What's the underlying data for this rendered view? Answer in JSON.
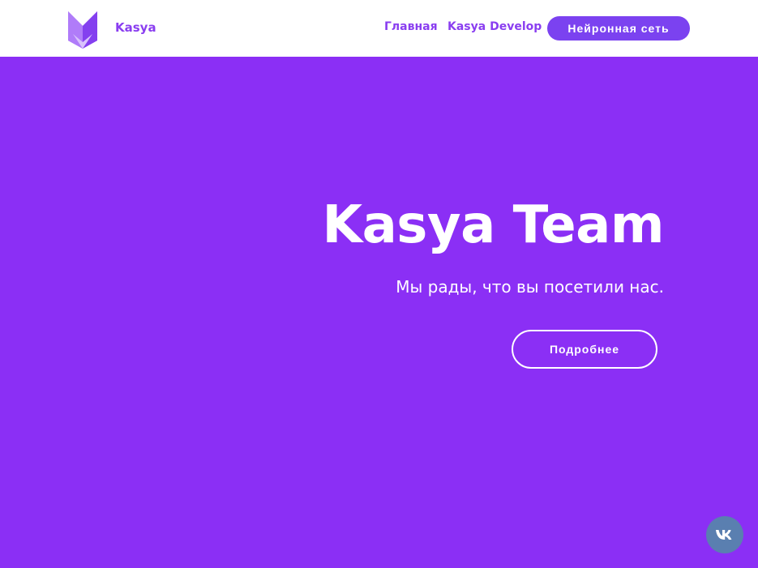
{
  "header": {
    "brand": "Kasya",
    "nav": [
      {
        "label": "Главная"
      },
      {
        "label": "Kasya Develop"
      }
    ],
    "cta_label": "Нейронная сеть"
  },
  "hero": {
    "title": "Kasya Team",
    "subtitle": "Мы рады, что вы посетили нас.",
    "button_label": "Подробнее"
  },
  "icons": {
    "logo": "fox-logo-icon",
    "social": "vk-icon"
  },
  "colors": {
    "page_background": "#8b2ff5",
    "header_background": "#ffffff",
    "accent": "#8a3ef0",
    "cta_background": "#7b42f0",
    "vk_button": "#5a7fb0"
  }
}
